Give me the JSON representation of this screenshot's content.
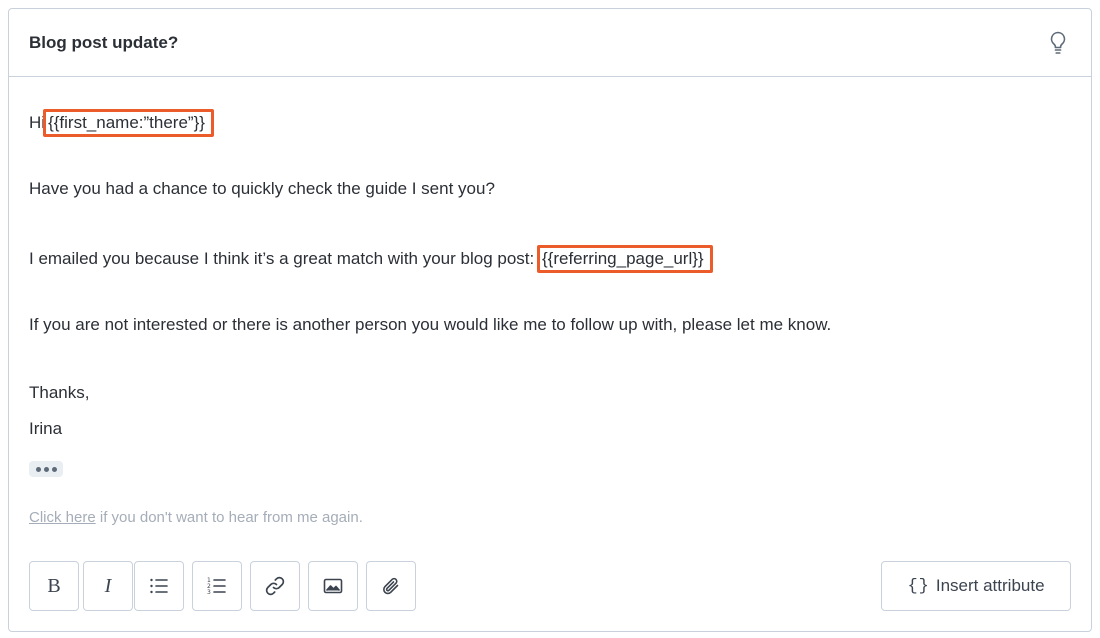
{
  "header": {
    "subject": "Blog post update?",
    "tip_icon": "lightbulb-icon"
  },
  "body": {
    "greeting_prefix": "Hi",
    "var_first_name": "{{first_name:”there”}}",
    "line2": "Have you had a chance to quickly check the guide I sent you?",
    "line3_prefix": "I emailed you because I think it’s a great match with your blog post: ",
    "var_referring_page": "{{referring_page_url}}",
    "line4": "If you are not interested or there is another person you would like me to follow up with, please let me know.",
    "signoff": "Thanks,",
    "signature": "Irina"
  },
  "unsubscribe": {
    "link_text": "Click here",
    "rest_text": " if you don't want to hear from me again."
  },
  "toolbar": {
    "bold_label": "B",
    "italic_label": "I",
    "insert_attribute_icon": "{}",
    "insert_attribute_label": "Insert attribute"
  },
  "colors": {
    "highlight": "#ec5b2a",
    "border": "#c9d2dc",
    "muted_text": "#a5adb8"
  }
}
